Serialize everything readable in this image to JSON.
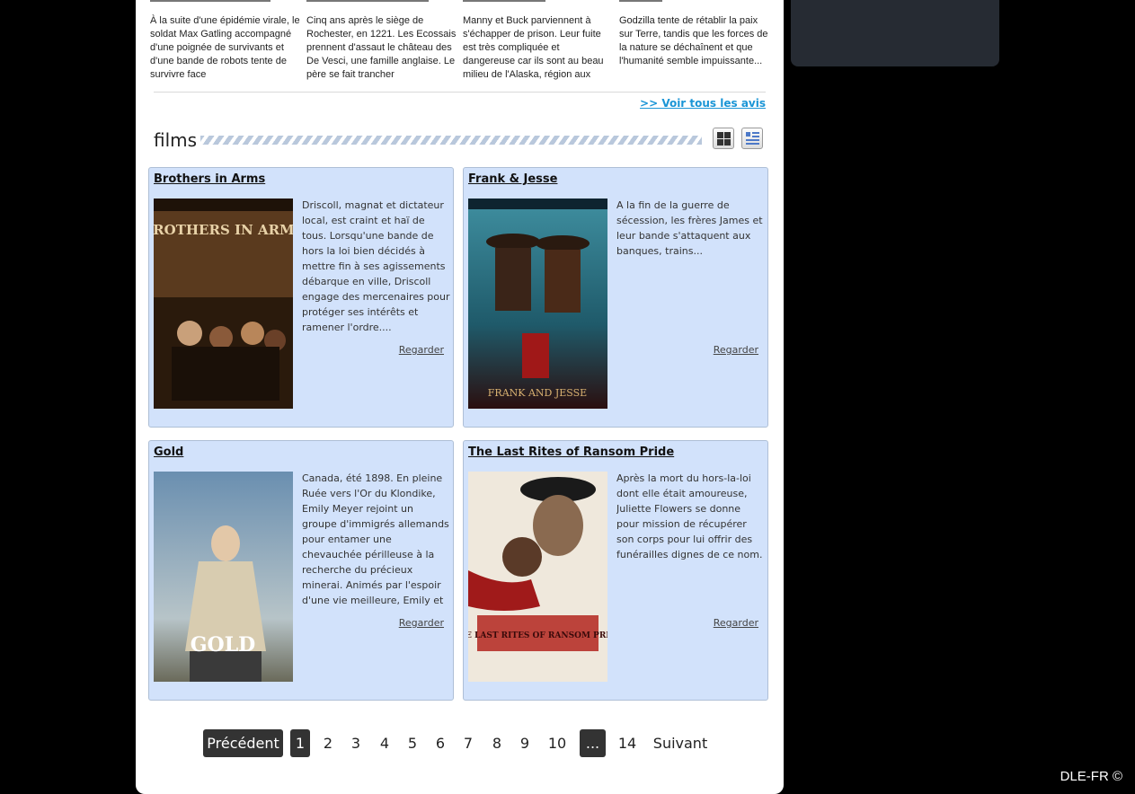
{
  "reviews": [
    {
      "text": "À la suite d'une épidémie virale, le soldat Max Gatling accompagné d'une poignée de survivants et d'une bande de robots tente de survivre face"
    },
    {
      "text": "Cinq ans après le siège de Rochester, en 1221. Les Ecossais prennent d'assaut le château des De Vesci, une famille anglaise. Le père se fait trancher"
    },
    {
      "text": "Manny et Buck parviennent à s'échapper de prison. Leur fuite est très compliquée et dangereuse car ils sont au beau milieu de l'Alaska, région aux"
    },
    {
      "text": "Godzilla tente de rétablir la paix sur Terre, tandis que les forces de la nature se déchaînent et que l'humanité semble impuissante..."
    }
  ],
  "all_reviews_link": ">> Voir tous les avis",
  "section_title": "films",
  "view_modes": [
    "grid-view-icon",
    "list-view-icon"
  ],
  "films": [
    {
      "title": "Brothers in Arms",
      "poster_text": "BROTHERS IN ARMS",
      "description": "Driscoll, magnat et dictateur local, est craint et haï de tous. Lorsqu'une bande de hors la loi bien décidés à mettre fin à ses agissements débarque en ville, Driscoll engage des mercenaires pour protéger ses intérêts et ramener l'ordre....",
      "watch": "Regarder"
    },
    {
      "title": "Frank & Jesse",
      "poster_text": "FRANK AND JESSE",
      "description": "A la fin de la guerre de sécession, les frères James et leur bande s'attaquent aux banques, trains...",
      "watch": "Regarder"
    },
    {
      "title": "Gold",
      "poster_text": "GOLD",
      "description": "Canada, été 1898. En pleine Ruée vers l'Or du Klondike, Emily Meyer rejoint un groupe d'immigrés allemands pour entamer une chevauchée périlleuse à la recherche du précieux minerai. Animés par l'espoir d'une vie meilleure, Emily et",
      "watch": "Regarder"
    },
    {
      "title": "The Last Rites of Ransom Pride",
      "poster_text": "THE LAST RITES OF RANSOM PRIDE",
      "description": "Après la mort du hors-la-loi dont elle était amoureuse, Juliette Flowers se donne pour mission de récupérer son corps pour lui offrir des funérailles dignes de ce nom.",
      "watch": "Regarder"
    }
  ],
  "pagination": {
    "prev": "Précédent",
    "pages": [
      "1",
      "2",
      "3",
      "4",
      "5",
      "6",
      "7",
      "8",
      "9",
      "10"
    ],
    "current": "1",
    "ellipsis": "...",
    "last": "14",
    "next": "Suivant"
  },
  "footer": "DLE-FR ©",
  "colors": {
    "card_bg": "#d2e2fb",
    "link": "#1a95d6",
    "page_bg": "#000000",
    "side_box": "#262b33"
  }
}
